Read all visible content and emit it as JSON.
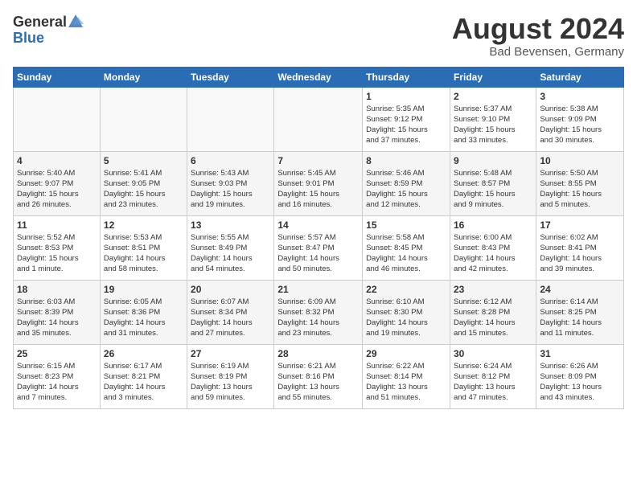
{
  "header": {
    "logo_general": "General",
    "logo_blue": "Blue",
    "title": "August 2024",
    "location": "Bad Bevensen, Germany"
  },
  "calendar": {
    "days_of_week": [
      "Sunday",
      "Monday",
      "Tuesday",
      "Wednesday",
      "Thursday",
      "Friday",
      "Saturday"
    ],
    "rows": [
      [
        {
          "day": "",
          "detail": ""
        },
        {
          "day": "",
          "detail": ""
        },
        {
          "day": "",
          "detail": ""
        },
        {
          "day": "",
          "detail": ""
        },
        {
          "day": "1",
          "detail": "Sunrise: 5:35 AM\nSunset: 9:12 PM\nDaylight: 15 hours\nand 37 minutes."
        },
        {
          "day": "2",
          "detail": "Sunrise: 5:37 AM\nSunset: 9:10 PM\nDaylight: 15 hours\nand 33 minutes."
        },
        {
          "day": "3",
          "detail": "Sunrise: 5:38 AM\nSunset: 9:09 PM\nDaylight: 15 hours\nand 30 minutes."
        }
      ],
      [
        {
          "day": "4",
          "detail": "Sunrise: 5:40 AM\nSunset: 9:07 PM\nDaylight: 15 hours\nand 26 minutes."
        },
        {
          "day": "5",
          "detail": "Sunrise: 5:41 AM\nSunset: 9:05 PM\nDaylight: 15 hours\nand 23 minutes."
        },
        {
          "day": "6",
          "detail": "Sunrise: 5:43 AM\nSunset: 9:03 PM\nDaylight: 15 hours\nand 19 minutes."
        },
        {
          "day": "7",
          "detail": "Sunrise: 5:45 AM\nSunset: 9:01 PM\nDaylight: 15 hours\nand 16 minutes."
        },
        {
          "day": "8",
          "detail": "Sunrise: 5:46 AM\nSunset: 8:59 PM\nDaylight: 15 hours\nand 12 minutes."
        },
        {
          "day": "9",
          "detail": "Sunrise: 5:48 AM\nSunset: 8:57 PM\nDaylight: 15 hours\nand 9 minutes."
        },
        {
          "day": "10",
          "detail": "Sunrise: 5:50 AM\nSunset: 8:55 PM\nDaylight: 15 hours\nand 5 minutes."
        }
      ],
      [
        {
          "day": "11",
          "detail": "Sunrise: 5:52 AM\nSunset: 8:53 PM\nDaylight: 15 hours\nand 1 minute."
        },
        {
          "day": "12",
          "detail": "Sunrise: 5:53 AM\nSunset: 8:51 PM\nDaylight: 14 hours\nand 58 minutes."
        },
        {
          "day": "13",
          "detail": "Sunrise: 5:55 AM\nSunset: 8:49 PM\nDaylight: 14 hours\nand 54 minutes."
        },
        {
          "day": "14",
          "detail": "Sunrise: 5:57 AM\nSunset: 8:47 PM\nDaylight: 14 hours\nand 50 minutes."
        },
        {
          "day": "15",
          "detail": "Sunrise: 5:58 AM\nSunset: 8:45 PM\nDaylight: 14 hours\nand 46 minutes."
        },
        {
          "day": "16",
          "detail": "Sunrise: 6:00 AM\nSunset: 8:43 PM\nDaylight: 14 hours\nand 42 minutes."
        },
        {
          "day": "17",
          "detail": "Sunrise: 6:02 AM\nSunset: 8:41 PM\nDaylight: 14 hours\nand 39 minutes."
        }
      ],
      [
        {
          "day": "18",
          "detail": "Sunrise: 6:03 AM\nSunset: 8:39 PM\nDaylight: 14 hours\nand 35 minutes."
        },
        {
          "day": "19",
          "detail": "Sunrise: 6:05 AM\nSunset: 8:36 PM\nDaylight: 14 hours\nand 31 minutes."
        },
        {
          "day": "20",
          "detail": "Sunrise: 6:07 AM\nSunset: 8:34 PM\nDaylight: 14 hours\nand 27 minutes."
        },
        {
          "day": "21",
          "detail": "Sunrise: 6:09 AM\nSunset: 8:32 PM\nDaylight: 14 hours\nand 23 minutes."
        },
        {
          "day": "22",
          "detail": "Sunrise: 6:10 AM\nSunset: 8:30 PM\nDaylight: 14 hours\nand 19 minutes."
        },
        {
          "day": "23",
          "detail": "Sunrise: 6:12 AM\nSunset: 8:28 PM\nDaylight: 14 hours\nand 15 minutes."
        },
        {
          "day": "24",
          "detail": "Sunrise: 6:14 AM\nSunset: 8:25 PM\nDaylight: 14 hours\nand 11 minutes."
        }
      ],
      [
        {
          "day": "25",
          "detail": "Sunrise: 6:15 AM\nSunset: 8:23 PM\nDaylight: 14 hours\nand 7 minutes."
        },
        {
          "day": "26",
          "detail": "Sunrise: 6:17 AM\nSunset: 8:21 PM\nDaylight: 14 hours\nand 3 minutes."
        },
        {
          "day": "27",
          "detail": "Sunrise: 6:19 AM\nSunset: 8:19 PM\nDaylight: 13 hours\nand 59 minutes."
        },
        {
          "day": "28",
          "detail": "Sunrise: 6:21 AM\nSunset: 8:16 PM\nDaylight: 13 hours\nand 55 minutes."
        },
        {
          "day": "29",
          "detail": "Sunrise: 6:22 AM\nSunset: 8:14 PM\nDaylight: 13 hours\nand 51 minutes."
        },
        {
          "day": "30",
          "detail": "Sunrise: 6:24 AM\nSunset: 8:12 PM\nDaylight: 13 hours\nand 47 minutes."
        },
        {
          "day": "31",
          "detail": "Sunrise: 6:26 AM\nSunset: 8:09 PM\nDaylight: 13 hours\nand 43 minutes."
        }
      ]
    ]
  }
}
